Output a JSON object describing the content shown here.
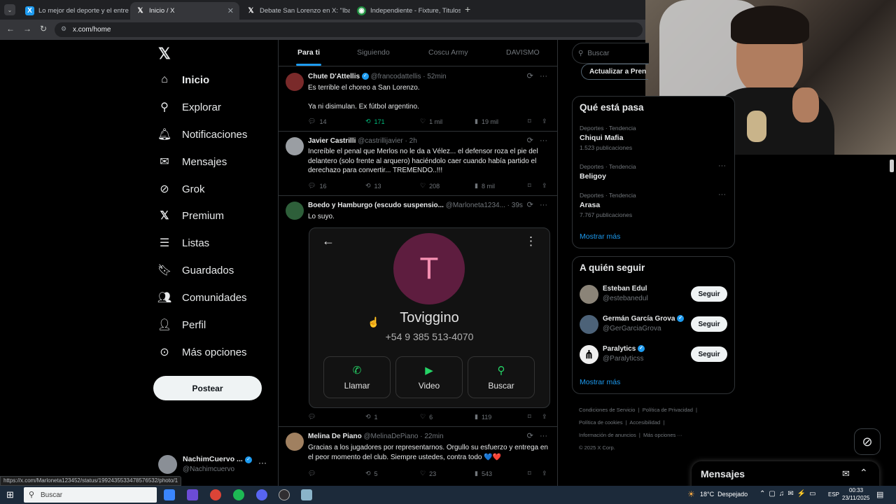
{
  "browser": {
    "tabs": [
      {
        "title": "Lo mejor del deporte y el entre",
        "favicon": "X"
      },
      {
        "title": "Inicio / X",
        "favicon": "X"
      },
      {
        "title": "Debate San Lorenzo en X: \"Iba",
        "favicon": "X"
      },
      {
        "title": "Independiente - Fixture, Titulos",
        "favicon": "globe"
      }
    ],
    "url": "x.com/home",
    "status_url": "https://x.com/Marloneta123452/status/1992435533478576532/photo/1"
  },
  "sidebar": {
    "items": [
      {
        "label": "Inicio",
        "icon": "home-icon"
      },
      {
        "label": "Explorar",
        "icon": "search-icon"
      },
      {
        "label": "Notificaciones",
        "icon": "bell-icon"
      },
      {
        "label": "Mensajes",
        "icon": "mail-icon"
      },
      {
        "label": "Grok",
        "icon": "grok-icon"
      },
      {
        "label": "Premium",
        "icon": "x-logo-icon"
      },
      {
        "label": "Listas",
        "icon": "list-icon"
      },
      {
        "label": "Guardados",
        "icon": "bookmark-icon"
      },
      {
        "label": "Comunidades",
        "icon": "people-icon"
      },
      {
        "label": "Perfil",
        "icon": "person-icon"
      },
      {
        "label": "Más opciones",
        "icon": "more-circle-icon"
      }
    ],
    "post_label": "Postear",
    "account": {
      "name": "NachimCuervo ...",
      "handle": "@Nachimcuervo"
    }
  },
  "feed_tabs": [
    "Para ti",
    "Siguiendo",
    "Coscu Army",
    "DAVISMO"
  ],
  "tweets": [
    {
      "name": "Chute D'Attellis",
      "handle": "@francodattellis",
      "time": "52min",
      "text1": "Es terrible el choreo a San Lorenzo.",
      "text2": "Ya ni disimulan. Ex fútbol argentino.",
      "replies": "14",
      "retweets": "171",
      "likes": "1 mil",
      "views": "19 mil"
    },
    {
      "name": "Javier Castrilli",
      "handle": "@castrillijavier",
      "time": "2h",
      "text1": "Increíble el penal que Merlos no le da a Vélez... el defensor roza el pie del delantero (solo frente al arquero) haciéndolo caer cuando había partido el derechazo para convertir... TREMENDO..!!!",
      "replies": "16",
      "retweets": "13",
      "likes": "208",
      "views": "8 mil"
    },
    {
      "name": "Boedo y Hamburgo (escudo suspensio...",
      "handle": "@Marloneta1234...",
      "time": "39s",
      "text1": "Lo suyo.",
      "replies": "",
      "retweets": "1",
      "likes": "6",
      "views": "119",
      "contact": {
        "initial": "T",
        "name": "Toviggino",
        "phone": "+54 9 385 513-4070",
        "buttons": [
          "Llamar",
          "Video",
          "Buscar"
        ]
      }
    },
    {
      "name": "Melina De Piano",
      "handle": "@MelinaDePiano",
      "time": "22min",
      "text1": "Gracias a los jugadores por representarnos. Orgullo su esfuerzo y entrega en el peor momento del club. Siempre ustedes, contra todo 💙❤️",
      "replies": "",
      "retweets": "5",
      "likes": "23",
      "views": "543"
    }
  ],
  "right": {
    "search_placeholder": "Buscar",
    "update_label": "Actualizar a Pren",
    "trends_title": "Qué está pasa",
    "trends": [
      {
        "category": "Deportes · Tendencia",
        "name": "Chiqui Mafia",
        "count": "1.523 publicaciones"
      },
      {
        "category": "Deportes · Tendencia",
        "name": "Beligoy",
        "count": ""
      },
      {
        "category": "Deportes · Tendencia",
        "name": "Arasa",
        "count": "7.767 publicaciones"
      }
    ],
    "show_more": "Mostrar más",
    "follow_title": "A quién seguir",
    "follow": [
      {
        "name": "Esteban Edul",
        "handle": "@estebanedul",
        "verified": false
      },
      {
        "name": "Germán García Grova",
        "handle": "@GerGarciaGrova",
        "verified": true
      },
      {
        "name": "Paralytics",
        "handle": "@Paralyticss",
        "verified": true
      }
    ],
    "follow_button": "Seguir",
    "footer": [
      "Condiciones de Servicio",
      "Política de Privacidad",
      "Política de cookies",
      "Accesibilidad",
      "Información de anuncios",
      "Más opciones ···",
      "© 2025 X Corp."
    ]
  },
  "messages_label": "Mensajes",
  "taskbar": {
    "search": "Buscar",
    "weather": "18°C  Despejado",
    "lang": "ESP",
    "time": "00:33",
    "date": "23/11/2025"
  },
  "colors": {
    "accent": "#1d9bf0",
    "retweet_green": "#00ba7c",
    "contact_avatar": "#5e1d3f",
    "contact_initial": "#f48fb1"
  }
}
